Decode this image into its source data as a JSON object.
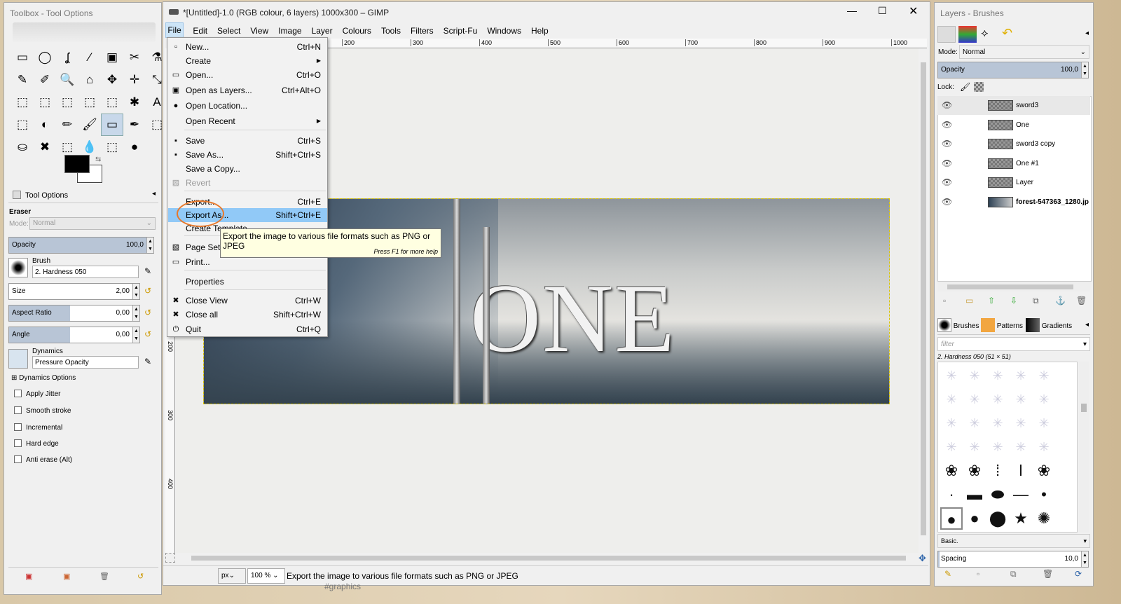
{
  "toolbox": {
    "title": "Toolbox - Tool Options",
    "tools": [
      "▭",
      "◯",
      "ʆ",
      "⁄",
      "▣",
      "✂",
      "⚗",
      "✎",
      "✐",
      "🔍",
      "⌂",
      "✥",
      "✛",
      "⤡",
      "⬚",
      "⬚",
      "⬚",
      "⬚",
      "⬚",
      "✱",
      "A",
      "⬚",
      "◐",
      "✏",
      "🖌",
      "▭",
      "✒",
      "⬚",
      "⛀",
      "✖",
      "⬚",
      "💧",
      "⬚",
      "●"
    ],
    "tool_options_tab": "Tool Options",
    "tool_name": "Eraser",
    "mode_label": "Mode:",
    "mode_value": "Normal",
    "opacity_label": "Opacity",
    "opacity_value": "100,0",
    "brush_label": "Brush",
    "brush_value": "2. Hardness 050",
    "size_label": "Size",
    "size_value": "2,00",
    "aspect_label": "Aspect Ratio",
    "aspect_value": "0,00",
    "angle_label": "Angle",
    "angle_value": "0,00",
    "dynamics_label": "Dynamics",
    "dynamics_value": "Pressure Opacity",
    "dynamics_options": "Dynamics Options",
    "apply_jitter": "Apply Jitter",
    "smooth_stroke": "Smooth stroke",
    "incremental": "Incremental",
    "hard_edge": "Hard edge",
    "anti_erase": "Anti erase  (Alt)"
  },
  "gimp": {
    "title": "*[Untitled]-1.0 (RGB colour, 6 layers) 1000x300 – GIMP",
    "menus": [
      "File",
      "Edit",
      "Select",
      "View",
      "Image",
      "Layer",
      "Colours",
      "Tools",
      "Filters",
      "Script-Fu",
      "Windows",
      "Help"
    ],
    "ruler_ticks": [
      "200",
      "300",
      "400",
      "500",
      "600",
      "700",
      "800",
      "900",
      "1000"
    ],
    "vruler_ticks": [
      "200",
      "300",
      "400"
    ],
    "canvas_text": "ONE",
    "unit": "px",
    "zoom": "100 %",
    "status": "Export the image to various file formats such as PNG or JPEG",
    "bg_text": "#graphics"
  },
  "file_menu": {
    "items": [
      {
        "label": "New...",
        "shortcut": "Ctrl+N",
        "icon": "▫"
      },
      {
        "label": "Create",
        "shortcut": "",
        "icon": "",
        "submenu": "▶"
      },
      {
        "label": "Open...",
        "shortcut": "Ctrl+O",
        "icon": "▭"
      },
      {
        "label": "Open as Layers...",
        "shortcut": "Ctrl+Alt+O",
        "icon": "▣"
      },
      {
        "label": "Open Location...",
        "shortcut": "",
        "icon": "●"
      },
      {
        "label": "Open Recent",
        "shortcut": "",
        "icon": "",
        "submenu": "▶"
      },
      {
        "label": "Save",
        "shortcut": "Ctrl+S",
        "icon": "▪"
      },
      {
        "label": "Save As...",
        "shortcut": "Shift+Ctrl+S",
        "icon": "▪"
      },
      {
        "label": "Save a Copy...",
        "shortcut": "",
        "icon": ""
      },
      {
        "label": "Revert",
        "shortcut": "",
        "icon": "▨"
      },
      {
        "label": "Export...",
        "shortcut": "Ctrl+E",
        "icon": ""
      },
      {
        "label": "Export As...",
        "shortcut": "Shift+Ctrl+E",
        "icon": ""
      },
      {
        "label": "Create Template...",
        "shortcut": "",
        "icon": ""
      },
      {
        "label": "Page Setup",
        "shortcut": "",
        "icon": "▧"
      },
      {
        "label": "Print...",
        "shortcut": "",
        "icon": "▭"
      },
      {
        "label": "Properties",
        "shortcut": "",
        "icon": ""
      },
      {
        "label": "Close View",
        "shortcut": "Ctrl+W",
        "icon": "✖"
      },
      {
        "label": "Close all",
        "shortcut": "Shift+Ctrl+W",
        "icon": "✖"
      },
      {
        "label": "Quit",
        "shortcut": "Ctrl+Q",
        "icon": "⏻"
      }
    ]
  },
  "tooltip": {
    "text": "Export the image to various file formats such as PNG or JPEG",
    "hint": "Press F1 for more help"
  },
  "layers": {
    "title": "Layers - Brushes",
    "mode_label": "Mode:",
    "mode_value": "Normal",
    "opacity_label": "Opacity",
    "opacity_value": "100,0",
    "lock_label": "Lock:",
    "items": [
      "sword3",
      "One",
      "sword3 copy",
      "One #1",
      "Layer",
      "forest-547363_1280.jp"
    ],
    "tabs": [
      "Brushes",
      "Patterns",
      "Gradients"
    ],
    "filter_placeholder": "filter",
    "brush_name": "2. Hardness 050 (51 × 51)",
    "brush_set": "Basic.",
    "spacing_label": "Spacing",
    "spacing_value": "10,0"
  }
}
